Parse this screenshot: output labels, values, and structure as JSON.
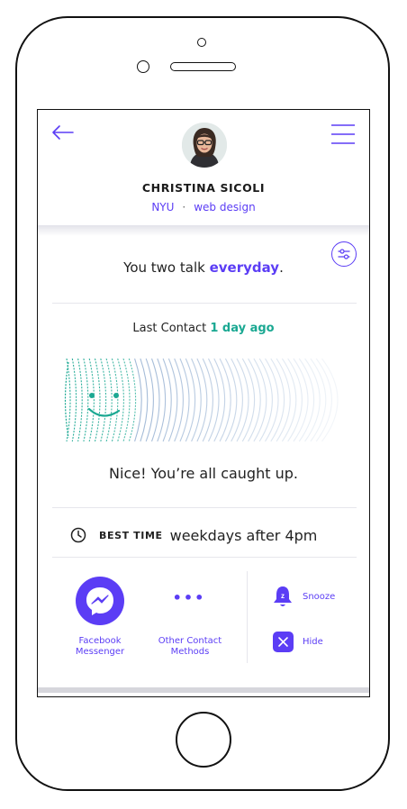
{
  "profile": {
    "name": "CHRISTINA SICOLI",
    "tags": [
      "NYU",
      "web design"
    ],
    "tag_separator": "·"
  },
  "frequency": {
    "prefix": "You two talk ",
    "value": "everyday",
    "suffix": "."
  },
  "last_contact": {
    "label": "Last Contact ",
    "value": "1 day ago"
  },
  "status_message": "Nice! You’re all caught up.",
  "best_time": {
    "label": "BEST TIME",
    "value": "weekdays after 4pm"
  },
  "actions": {
    "messenger_label_line1": "Facebook",
    "messenger_label_line2": "Messenger",
    "other_dots": "•••",
    "other_label_line1": "Other Contact",
    "other_label_line2": "Methods",
    "snooze_label": "Snooze",
    "bell_letter": "z",
    "hide_label": "Hide"
  },
  "colors": {
    "accent": "#5b3df5",
    "teal": "#1aa892",
    "text": "#222222"
  },
  "icons": [
    "back-arrow-icon",
    "hamburger-menu-icon",
    "filter-icon",
    "clock-icon",
    "messenger-icon",
    "bell-icon",
    "close-icon"
  ]
}
